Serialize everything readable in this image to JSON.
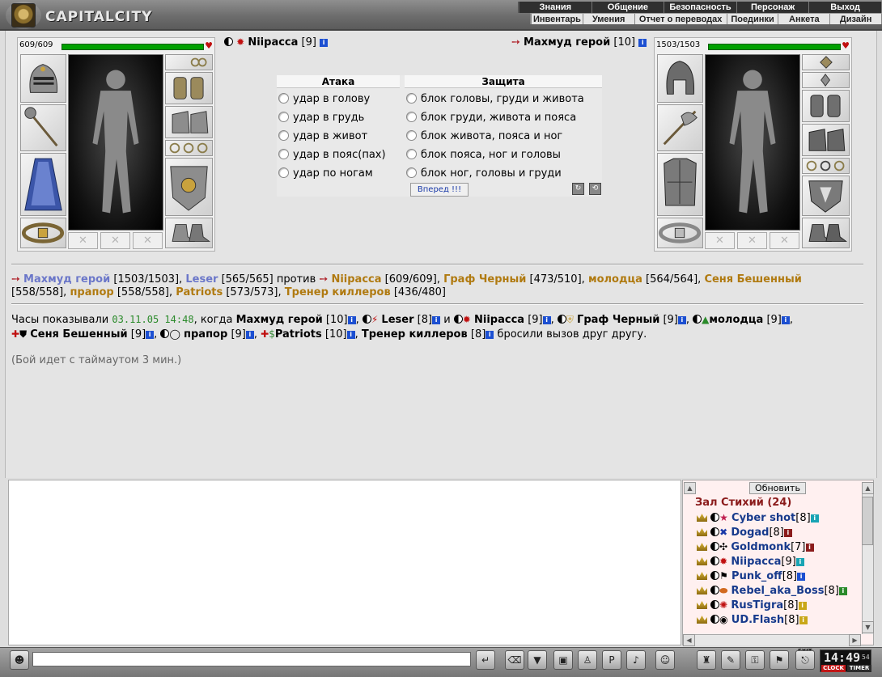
{
  "app": {
    "logo_text": "CAPITALCITY"
  },
  "menu_top": [
    "Знания",
    "Общение",
    "Безопасность",
    "Персонаж",
    "Выход"
  ],
  "menu_bottom": [
    "Инвентарь",
    "Умения",
    "Отчет о переводах",
    "Поединки",
    "Анкета",
    "Дизайн"
  ],
  "player_left": {
    "hp_text": "609/609",
    "hp_fraction": 1.0,
    "name": "Niipacca",
    "level": "[9]"
  },
  "player_right": {
    "hp_text": "1503/1503",
    "hp_fraction": 1.0,
    "name": "Махмуд герой",
    "level": "[10]"
  },
  "attack": {
    "head": "Атака",
    "options": [
      "удар в голову",
      "удар в грудь",
      "удар в живот",
      "удар в пояс(пах)",
      "удар по ногам"
    ]
  },
  "defense": {
    "head": "Защита",
    "options": [
      "блок головы, груди и живота",
      "блок груди, живота и пояса",
      "блок живота, пояса и ног",
      "блок пояса, ног и головы",
      "блок ног, головы и груди"
    ]
  },
  "go_button": "Вперед !!!",
  "teams": {
    "team1": [
      {
        "name": "Махмуд герой",
        "hp": "[1503/1503]",
        "suffix": ","
      },
      {
        "name": "Leser",
        "hp": "[565/565]",
        "suffix": ""
      }
    ],
    "vs_word": "против",
    "team2_line1": [
      {
        "name": "Niipacca",
        "hp": "[609/609]",
        "suffix": ","
      },
      {
        "name": "Граф Черный",
        "hp": "[473/510]",
        "suffix": ","
      },
      {
        "name": "молодца",
        "hp": "[564/564]",
        "suffix": ","
      },
      {
        "name": "Сеня Бешенный",
        "hp": "",
        "suffix": ""
      }
    ],
    "team2_line2_prefix": "[558/558],",
    "team2_line2": [
      {
        "name": "прапор",
        "hp": "[558/558]",
        "suffix": ","
      },
      {
        "name": "Patriots",
        "hp": "[573/573]",
        "suffix": ","
      },
      {
        "name": "Тренер киллеров",
        "hp": "[436/480]",
        "suffix": ""
      }
    ]
  },
  "log": {
    "prefix": "Часы показывали",
    "date": "03.11.05 14:48",
    "when": ", когда",
    "p1_name": "Махмуд герой",
    "p1_level": "[10]",
    "p2_name": "Leser",
    "p2_level": "[8]",
    "and": "и",
    "p3_name": "Niipacca",
    "p3_level": "[9]",
    "p4_name": "Граф Черный",
    "p4_level": "[9]",
    "p5_name": "молодца",
    "p5_level": "[9]",
    "p6_name": "Сеня Бешенный",
    "p6_level": "[9]",
    "p7_name": "прапор",
    "p7_level": "[9]",
    "p8_name": "Patriots",
    "p8_level": "[10]",
    "p9_name": "Тренер киллеров",
    "p9_level": "[8]",
    "ending": "бросили вызов друг другу.",
    "timeout": "(Бой идет с таймаутом 3 мин.)"
  },
  "chat": {
    "refresh": "Обновить",
    "room_title": "Зал Стихий (24)",
    "players": [
      {
        "name": "Cyber shot",
        "level": "[8]"
      },
      {
        "name": "Dogad",
        "level": "[8]"
      },
      {
        "name": "Goldmonk",
        "level": "[7]"
      },
      {
        "name": "Niipacca",
        "level": "[9]"
      },
      {
        "name": "Punk_off",
        "level": "[8]"
      },
      {
        "name": "Rebel_aka_Boss",
        "level": "[8]"
      },
      {
        "name": "RusTigra",
        "level": "[8]"
      },
      {
        "name": "UD.Flash",
        "level": "[8]"
      }
    ]
  },
  "clock": {
    "time": "14:49",
    "seconds": "54",
    "label_clock": "CLOCK",
    "label_timer": "TIMER"
  },
  "exit_label": "EXIT",
  "colors": {
    "hp_bar": "#00a000",
    "player_link_blue": "#6b77c9",
    "player_link_gold": "#b07a10",
    "room_title": "#8b1c1c"
  }
}
